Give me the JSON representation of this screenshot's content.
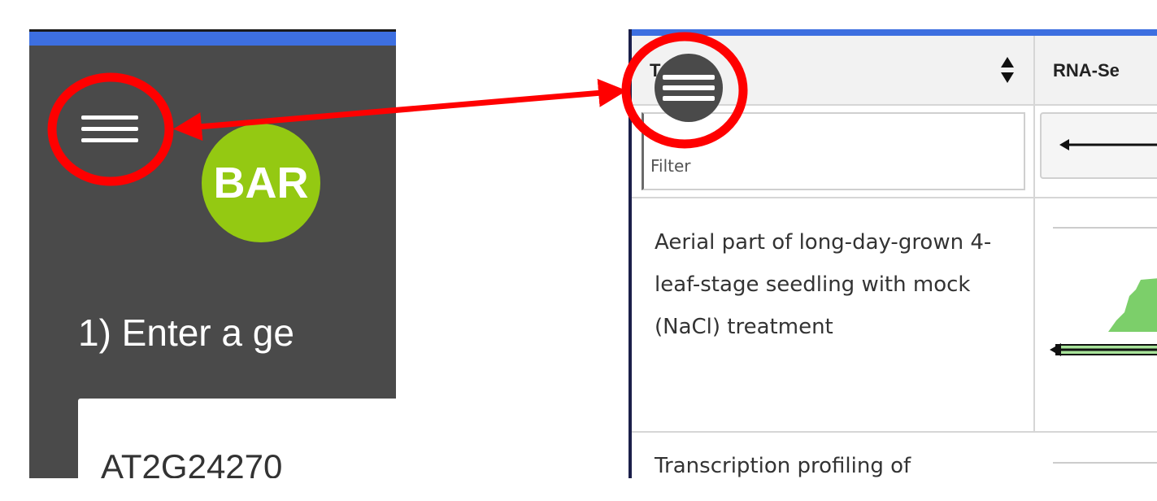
{
  "left_panel": {
    "logo_text": "BAR",
    "instruction_text": "1) Enter a ge",
    "gene_input_value": "AT2G24270",
    "menu_icon": "hamburger-menu-icon"
  },
  "right_panel": {
    "column_header_1": "T",
    "column_header_2": "RNA-Se",
    "filter_placeholder": "Filter",
    "row_1_text": "Aerial part of long-day-grown 4-leaf-stage seedling with mock (NaCl) treatment",
    "row_2_text": "Transcription profiling of",
    "menu_icon": "hamburger-menu-icon",
    "sort_icon": "sort-arrows-icon"
  },
  "colors": {
    "dark_panel": "#4a4a4a",
    "blue_bar": "#3d6fe0",
    "logo_green": "#94c912",
    "annotation_red": "#ff0000",
    "track_green": "#7ccf6a"
  }
}
